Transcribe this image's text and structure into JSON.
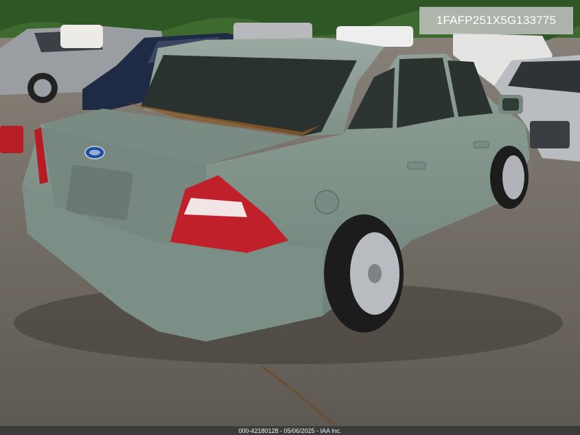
{
  "photo": {
    "vin_label": "1FAFP251X5G133775",
    "footer_caption": "000-42180128 - 05/06/2025 - IAA Inc.",
    "colors": {
      "car_body": "#7f9389",
      "taillight": "#c0202a",
      "gravel": "#6f6a63",
      "foliage": "#3e6a30"
    },
    "icons": [
      "ford-oval-emblem"
    ]
  }
}
